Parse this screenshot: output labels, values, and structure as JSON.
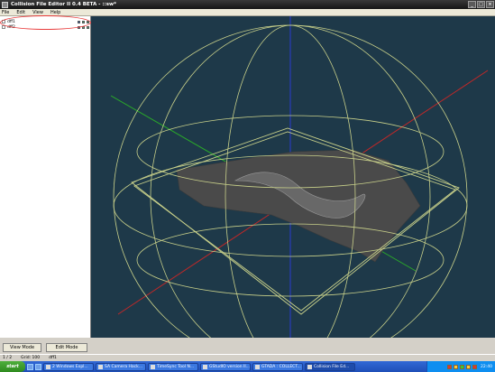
{
  "window": {
    "title": "Collision File Editor II 0.4 BETA - ::sw*",
    "minimize_glyph": "_",
    "maximize_glyph": "□",
    "close_glyph": "×"
  },
  "menu": {
    "file": "File",
    "edit": "Edit",
    "view": "View",
    "help": "Help"
  },
  "tree": {
    "items": [
      {
        "label": "dff1",
        "icons": [
          "eye-icon",
          "lock-icon",
          "flag-icon"
        ]
      },
      {
        "label": "dff2",
        "icons": [
          "eye-icon",
          "lock-icon",
          "flag-icon"
        ]
      }
    ]
  },
  "modes": {
    "view_label": "View Mode",
    "edit_label": "Edit Mode"
  },
  "status": {
    "index": "1 / 2",
    "grid": "Grid: 100",
    "model": "dff1"
  },
  "taskbar": {
    "start_label": "start",
    "tasks": [
      {
        "label": "2 Windows Expl..."
      },
      {
        "label": "SA Camera Hack..."
      },
      {
        "label": "TimeSync Tool N..."
      },
      {
        "label": "GStudIO version II..."
      },
      {
        "label": "GTADA : COLLECT..."
      },
      {
        "label": "Collision File Ed..."
      }
    ],
    "clock": "22:40"
  },
  "colors": {
    "viewport_bg": "#1e3949",
    "wireframe": "#c8d08a",
    "axis_x": "#d02828",
    "axis_y": "#2a3cd0",
    "axis_z": "#2aa82a",
    "mesh": "#4a4a4a",
    "highlight": "#e83a3a"
  }
}
